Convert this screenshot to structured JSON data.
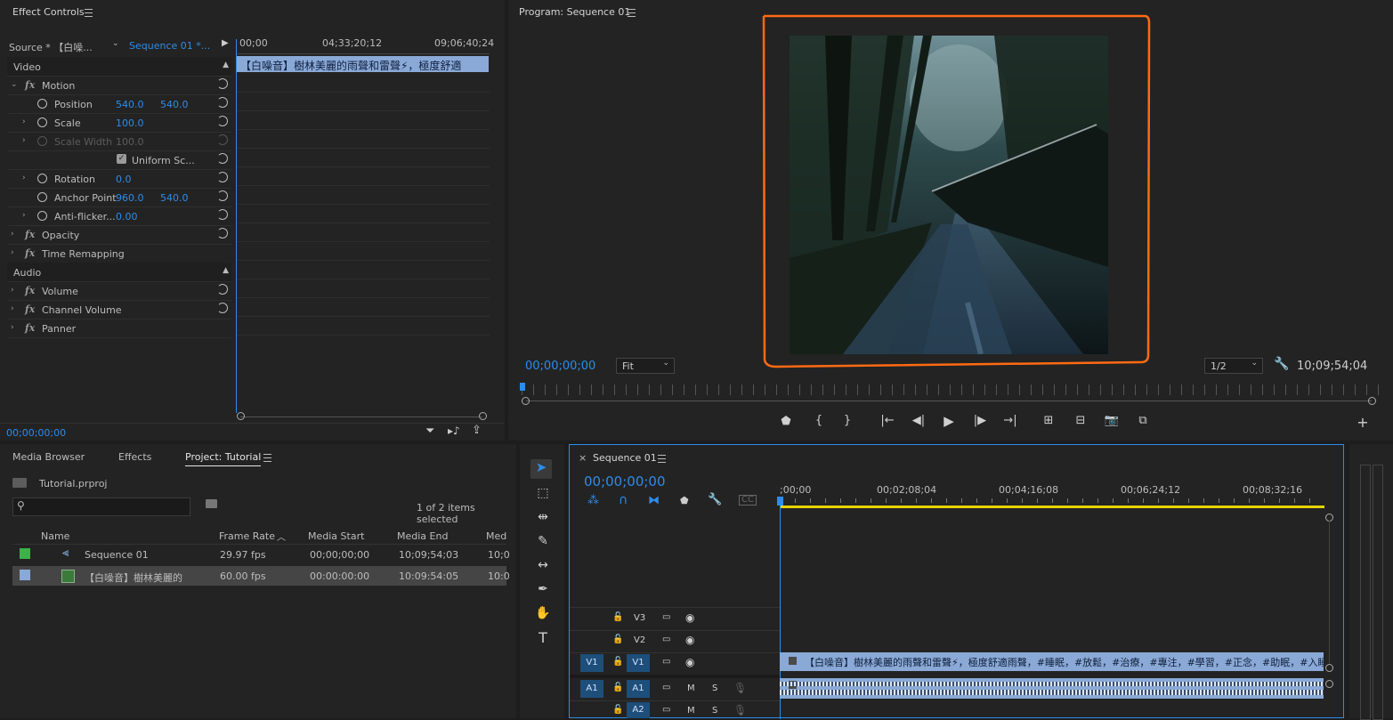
{
  "effect_controls": {
    "panel_title": "Effect Controls",
    "source_label": "Source * 【白噪...",
    "sequence_label": "Sequence 01 *...",
    "ruler": [
      "00;00",
      "04;33;20;12",
      "09;06;40;24"
    ],
    "clip_label": "【白噪音】樹林美麗的雨聲和雷聲⚡，極度舒適",
    "video_header": "Video",
    "audio_header": "Audio",
    "motion": "Motion",
    "position_label": "Position",
    "position_x": "540.0",
    "position_y": "540.0",
    "scale_label": "Scale",
    "scale_value": "100.0",
    "scale_width_label": "Scale Width",
    "scale_width_value": "100.0",
    "uniform_scale_label": "Uniform Sc...",
    "rotation_label": "Rotation",
    "rotation_value": "0.0",
    "anchor_label": "Anchor Point",
    "anchor_x": "960.0",
    "anchor_y": "540.0",
    "antiflicker_label": "Anti-flicker...",
    "antiflicker_value": "0.00",
    "opacity": "Opacity",
    "time_remapping": "Time Remapping",
    "volume": "Volume",
    "channel_volume": "Channel Volume",
    "panner": "Panner",
    "timecode": "00;00;00;00"
  },
  "program": {
    "panel_title": "Program: Sequence 01",
    "timecode": "00;00;00;00",
    "fit": "Fit",
    "resolution": "1/2",
    "duration": "10;09;54;04"
  },
  "project": {
    "tabs": [
      "Media Browser",
      "Effects",
      "Project: Tutorial"
    ],
    "file": "Tutorial.prproj",
    "selection_status": "1 of 2 items selected",
    "columns": [
      "Name",
      "Frame Rate",
      "Media Start",
      "Media End",
      "Med"
    ],
    "rows": [
      {
        "name": "Sequence 01",
        "fps": "29.97 fps",
        "start": "00;00;00;00",
        "end": "10;09;54;03",
        "extra": "10;0",
        "color": "#3fb04a"
      },
      {
        "name": "【白噪音】樹林美麗的",
        "fps": "60.00 fps",
        "start": "00:00:00:00",
        "end": "10:09:54:05",
        "extra": "10:0",
        "color": "#8aa9d6"
      }
    ]
  },
  "timeline": {
    "tab_title": "Sequence 01",
    "timecode": "00;00;00;00",
    "ruler": [
      ";00;00",
      "00;02;08;04",
      "00;04;16;08",
      "00;06;24;12",
      "00;08;32;16"
    ],
    "tracks": {
      "v3": "V3",
      "v2": "V2",
      "v1_src": "V1",
      "v1": "V1",
      "a1_src": "A1",
      "a1": "A1",
      "a2": "A2",
      "m": "M",
      "s": "S"
    },
    "clip_label": "【白噪音】樹林美麗的雨聲和雷聲⚡，極度舒適雨聲，#睡眠，#放鬆，#治療，#專注，#學習，#正念，#助眠，#入睡，"
  },
  "colors": {
    "accent": "#2d8ceb",
    "highlight": "#ff6a13",
    "clip": "#8aa9d6",
    "playhead": "#2d8ceb"
  }
}
